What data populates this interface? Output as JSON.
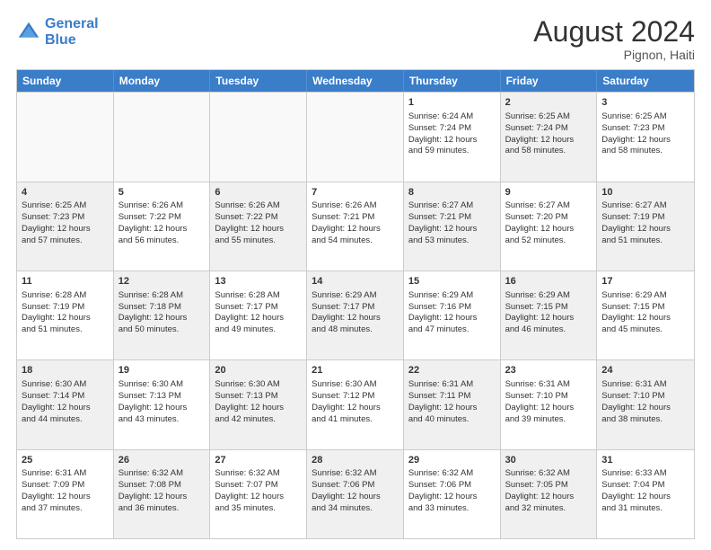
{
  "header": {
    "logo_line1": "General",
    "logo_line2": "Blue",
    "month_year": "August 2024",
    "location": "Pignon, Haiti"
  },
  "weekdays": [
    "Sunday",
    "Monday",
    "Tuesday",
    "Wednesday",
    "Thursday",
    "Friday",
    "Saturday"
  ],
  "rows": [
    [
      {
        "day": "",
        "info": "",
        "shaded": false,
        "empty": true
      },
      {
        "day": "",
        "info": "",
        "shaded": false,
        "empty": true
      },
      {
        "day": "",
        "info": "",
        "shaded": false,
        "empty": true
      },
      {
        "day": "",
        "info": "",
        "shaded": false,
        "empty": true
      },
      {
        "day": "1",
        "info": "Sunrise: 6:24 AM\nSunset: 7:24 PM\nDaylight: 12 hours\nand 59 minutes.",
        "shaded": false,
        "empty": false
      },
      {
        "day": "2",
        "info": "Sunrise: 6:25 AM\nSunset: 7:24 PM\nDaylight: 12 hours\nand 58 minutes.",
        "shaded": true,
        "empty": false
      },
      {
        "day": "3",
        "info": "Sunrise: 6:25 AM\nSunset: 7:23 PM\nDaylight: 12 hours\nand 58 minutes.",
        "shaded": false,
        "empty": false
      }
    ],
    [
      {
        "day": "4",
        "info": "Sunrise: 6:25 AM\nSunset: 7:23 PM\nDaylight: 12 hours\nand 57 minutes.",
        "shaded": true,
        "empty": false
      },
      {
        "day": "5",
        "info": "Sunrise: 6:26 AM\nSunset: 7:22 PM\nDaylight: 12 hours\nand 56 minutes.",
        "shaded": false,
        "empty": false
      },
      {
        "day": "6",
        "info": "Sunrise: 6:26 AM\nSunset: 7:22 PM\nDaylight: 12 hours\nand 55 minutes.",
        "shaded": true,
        "empty": false
      },
      {
        "day": "7",
        "info": "Sunrise: 6:26 AM\nSunset: 7:21 PM\nDaylight: 12 hours\nand 54 minutes.",
        "shaded": false,
        "empty": false
      },
      {
        "day": "8",
        "info": "Sunrise: 6:27 AM\nSunset: 7:21 PM\nDaylight: 12 hours\nand 53 minutes.",
        "shaded": true,
        "empty": false
      },
      {
        "day": "9",
        "info": "Sunrise: 6:27 AM\nSunset: 7:20 PM\nDaylight: 12 hours\nand 52 minutes.",
        "shaded": false,
        "empty": false
      },
      {
        "day": "10",
        "info": "Sunrise: 6:27 AM\nSunset: 7:19 PM\nDaylight: 12 hours\nand 51 minutes.",
        "shaded": true,
        "empty": false
      }
    ],
    [
      {
        "day": "11",
        "info": "Sunrise: 6:28 AM\nSunset: 7:19 PM\nDaylight: 12 hours\nand 51 minutes.",
        "shaded": false,
        "empty": false
      },
      {
        "day": "12",
        "info": "Sunrise: 6:28 AM\nSunset: 7:18 PM\nDaylight: 12 hours\nand 50 minutes.",
        "shaded": true,
        "empty": false
      },
      {
        "day": "13",
        "info": "Sunrise: 6:28 AM\nSunset: 7:17 PM\nDaylight: 12 hours\nand 49 minutes.",
        "shaded": false,
        "empty": false
      },
      {
        "day": "14",
        "info": "Sunrise: 6:29 AM\nSunset: 7:17 PM\nDaylight: 12 hours\nand 48 minutes.",
        "shaded": true,
        "empty": false
      },
      {
        "day": "15",
        "info": "Sunrise: 6:29 AM\nSunset: 7:16 PM\nDaylight: 12 hours\nand 47 minutes.",
        "shaded": false,
        "empty": false
      },
      {
        "day": "16",
        "info": "Sunrise: 6:29 AM\nSunset: 7:15 PM\nDaylight: 12 hours\nand 46 minutes.",
        "shaded": true,
        "empty": false
      },
      {
        "day": "17",
        "info": "Sunrise: 6:29 AM\nSunset: 7:15 PM\nDaylight: 12 hours\nand 45 minutes.",
        "shaded": false,
        "empty": false
      }
    ],
    [
      {
        "day": "18",
        "info": "Sunrise: 6:30 AM\nSunset: 7:14 PM\nDaylight: 12 hours\nand 44 minutes.",
        "shaded": true,
        "empty": false
      },
      {
        "day": "19",
        "info": "Sunrise: 6:30 AM\nSunset: 7:13 PM\nDaylight: 12 hours\nand 43 minutes.",
        "shaded": false,
        "empty": false
      },
      {
        "day": "20",
        "info": "Sunrise: 6:30 AM\nSunset: 7:13 PM\nDaylight: 12 hours\nand 42 minutes.",
        "shaded": true,
        "empty": false
      },
      {
        "day": "21",
        "info": "Sunrise: 6:30 AM\nSunset: 7:12 PM\nDaylight: 12 hours\nand 41 minutes.",
        "shaded": false,
        "empty": false
      },
      {
        "day": "22",
        "info": "Sunrise: 6:31 AM\nSunset: 7:11 PM\nDaylight: 12 hours\nand 40 minutes.",
        "shaded": true,
        "empty": false
      },
      {
        "day": "23",
        "info": "Sunrise: 6:31 AM\nSunset: 7:10 PM\nDaylight: 12 hours\nand 39 minutes.",
        "shaded": false,
        "empty": false
      },
      {
        "day": "24",
        "info": "Sunrise: 6:31 AM\nSunset: 7:10 PM\nDaylight: 12 hours\nand 38 minutes.",
        "shaded": true,
        "empty": false
      }
    ],
    [
      {
        "day": "25",
        "info": "Sunrise: 6:31 AM\nSunset: 7:09 PM\nDaylight: 12 hours\nand 37 minutes.",
        "shaded": false,
        "empty": false
      },
      {
        "day": "26",
        "info": "Sunrise: 6:32 AM\nSunset: 7:08 PM\nDaylight: 12 hours\nand 36 minutes.",
        "shaded": true,
        "empty": false
      },
      {
        "day": "27",
        "info": "Sunrise: 6:32 AM\nSunset: 7:07 PM\nDaylight: 12 hours\nand 35 minutes.",
        "shaded": false,
        "empty": false
      },
      {
        "day": "28",
        "info": "Sunrise: 6:32 AM\nSunset: 7:06 PM\nDaylight: 12 hours\nand 34 minutes.",
        "shaded": true,
        "empty": false
      },
      {
        "day": "29",
        "info": "Sunrise: 6:32 AM\nSunset: 7:06 PM\nDaylight: 12 hours\nand 33 minutes.",
        "shaded": false,
        "empty": false
      },
      {
        "day": "30",
        "info": "Sunrise: 6:32 AM\nSunset: 7:05 PM\nDaylight: 12 hours\nand 32 minutes.",
        "shaded": true,
        "empty": false
      },
      {
        "day": "31",
        "info": "Sunrise: 6:33 AM\nSunset: 7:04 PM\nDaylight: 12 hours\nand 31 minutes.",
        "shaded": false,
        "empty": false
      }
    ]
  ]
}
